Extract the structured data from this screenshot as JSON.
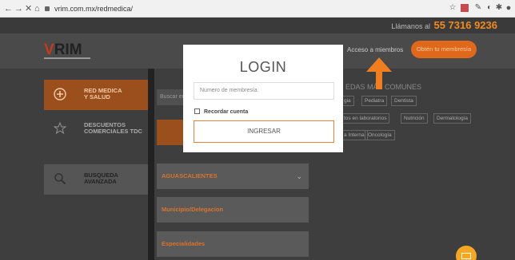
{
  "browser": {
    "url": "vrim.com.mx/redmedica/",
    "nav_back": "←",
    "nav_forward": "→",
    "nav_close": "✕",
    "nav_home": "⌂"
  },
  "topbar": {
    "call_label": "Llámanos al",
    "phone": "55 7316 9236"
  },
  "header": {
    "logo": "VRIM",
    "logo_v": "V",
    "logo_rest": "RIM",
    "acceso_label": "Acceso a miembros",
    "obten_label": "Obtén tu membresía"
  },
  "sidebar": {
    "items": [
      {
        "label_1": "RED MEDICA",
        "label_2": "Y SALUD"
      },
      {
        "label_1": "DESCUENTOS",
        "label_2": "COMERCIALES TDC"
      },
      {
        "label_1": "BUSQUEDA",
        "label_2": "AVANZADA"
      }
    ]
  },
  "search": {
    "placeholder": "Buscar en"
  },
  "dropdowns": [
    {
      "label": "AGUASCALIENTES"
    },
    {
      "label": "Municipio/Delegacion"
    },
    {
      "label": "Especialidades"
    }
  ],
  "busquedas": {
    "heading": "EDAS MÁS COMUNES",
    "tags": [
      "gia",
      "Pediatra",
      "Dentista",
      "tos en laboratorios",
      "Nutrición",
      "Dermatología",
      "a Interna",
      "Oncología"
    ]
  },
  "modal": {
    "title": "LOGIN",
    "membership_placeholder": "Numero de membresía",
    "remember_label": "Recordar cuenta",
    "submit_label": "INGRESAR"
  },
  "colors": {
    "accent": "#f07d1e",
    "brand_red": "#c53a1c"
  }
}
